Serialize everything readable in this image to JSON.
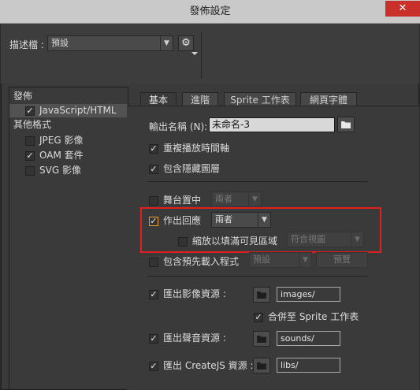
{
  "window": {
    "title": "發佈設定",
    "close_symbol": "✕"
  },
  "profile": {
    "label": "描述檔 :",
    "value": "預設"
  },
  "left_tree": {
    "publish_heading": "發佈",
    "publish_items": [
      {
        "label": "JavaScript/HTML",
        "checked": true
      }
    ],
    "other_heading": "其他格式",
    "other_items": [
      {
        "label": "JPEG 影像",
        "checked": false
      },
      {
        "label": "OAM 套件",
        "checked": true
      },
      {
        "label": "SVG 影像",
        "checked": false
      }
    ]
  },
  "tabs": [
    {
      "label": "基本"
    },
    {
      "label": "進階"
    },
    {
      "label": "Sprite 工作表"
    },
    {
      "label": "網頁字體"
    }
  ],
  "basic": {
    "output_label": "輸出名稱 (N):",
    "output_value": "未命名-3",
    "loop_timeline": {
      "label": "重複播放時間軸",
      "checked": true
    },
    "include_hidden": {
      "label": "包含隱藏圖層",
      "checked": true
    },
    "center_stage": {
      "label": "舞台置中",
      "checked": false,
      "value": "兩者"
    },
    "make_responsive": {
      "label": "作出回應",
      "checked": true,
      "value": "兩者"
    },
    "scale_to_fill": {
      "label": "縮放以填滿可見區域",
      "checked": false,
      "value": "符合視圖"
    },
    "include_preloader": {
      "label": "包含預先載入程式",
      "checked": false,
      "value": "預設",
      "preview_label": "預覽"
    },
    "export_images": {
      "label": "匯出影像資源 :",
      "checked": true,
      "path": "images/"
    },
    "combine_sprite": {
      "label": "合併至 Sprite 工作表",
      "checked": true
    },
    "export_sounds": {
      "label": "匯出聲音資源 :",
      "checked": true,
      "path": "sounds/"
    },
    "export_createjs": {
      "label": "匯出 CreateJS 資源 :",
      "checked": true,
      "path": "libs/"
    }
  },
  "colors": {
    "highlight_box": "#e11f1f",
    "close_button": "#c9302c"
  }
}
